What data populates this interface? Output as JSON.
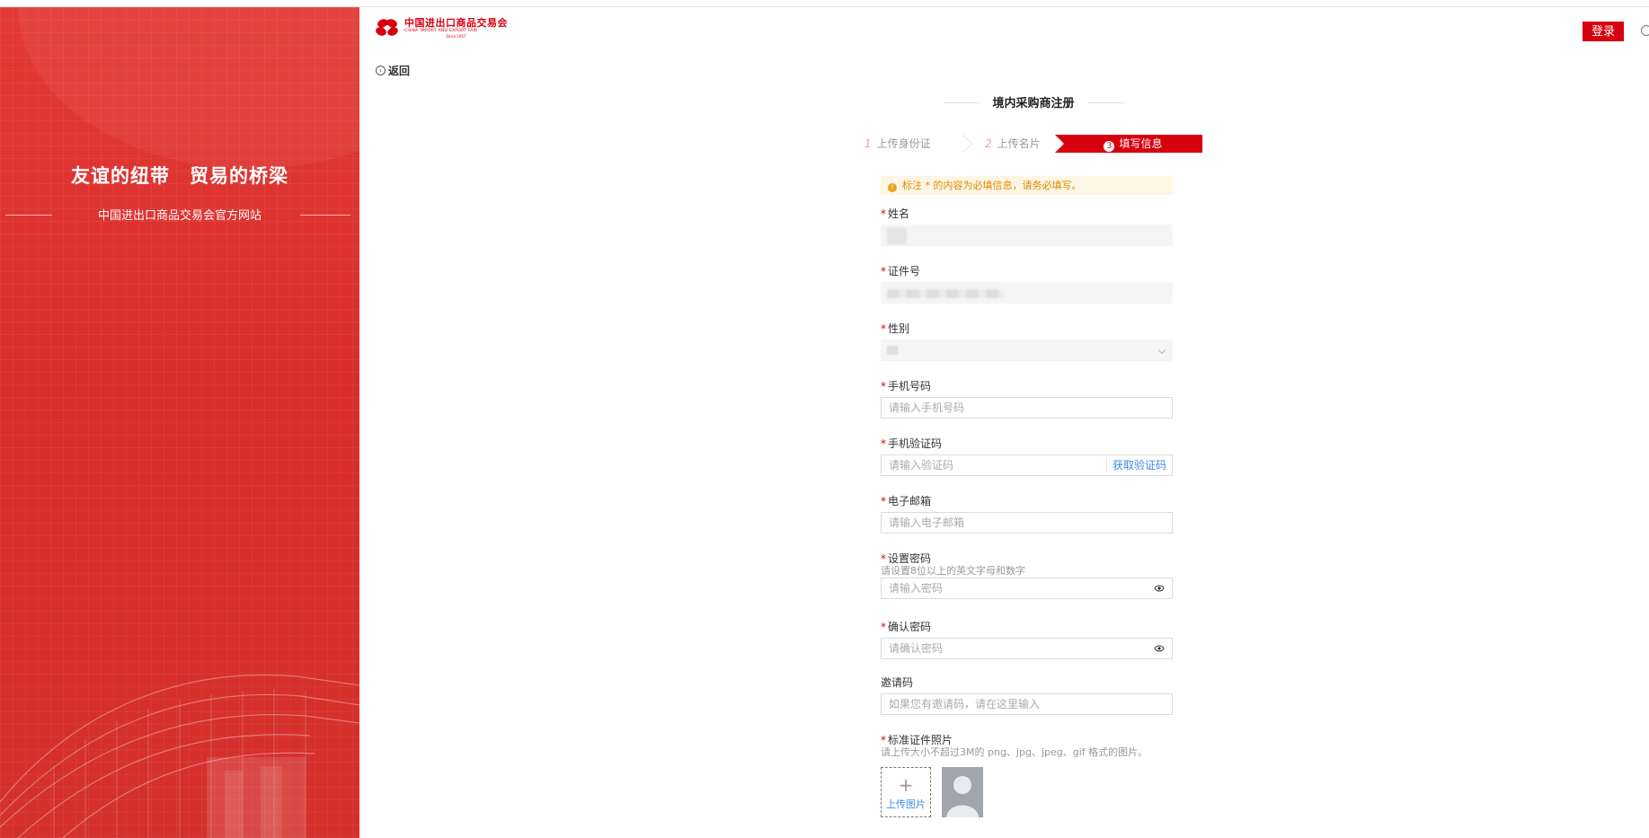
{
  "left": {
    "slogan": "友谊的纽带　贸易的桥梁",
    "subtitle": "中国进出口商品交易会官方网站"
  },
  "header": {
    "logo_cn": "中国进出口商品交易会",
    "logo_en": "CHINA IMPORT AND EXPORT FAIR",
    "logo_since": "Since 1957",
    "back": "返回",
    "login": "登录"
  },
  "form": {
    "title": "境内采购商注册",
    "steps": [
      {
        "num": "1",
        "label": "上传身份证"
      },
      {
        "num": "2",
        "label": "上传名片"
      },
      {
        "num": "3",
        "label": "填写信息"
      }
    ],
    "notice": "标注 * 的内容为必填信息，请务必填写。",
    "fields": {
      "name": {
        "label": "姓名"
      },
      "id_no": {
        "label": "证件号"
      },
      "gender": {
        "label": "性别"
      },
      "phone": {
        "label": "手机号码",
        "placeholder": "请输入手机号码"
      },
      "sms_code": {
        "label": "手机验证码",
        "placeholder": "请输入验证码",
        "action": "获取验证码"
      },
      "email": {
        "label": "电子邮箱",
        "placeholder": "请输入电子邮箱"
      },
      "password": {
        "label": "设置密码",
        "hint": "请设置8位以上的英文字母和数字",
        "placeholder": "请输入密码"
      },
      "confirm": {
        "label": "确认密码",
        "placeholder": "请确认密码"
      },
      "invite": {
        "label": "邀请码",
        "placeholder": "如果您有邀请码，请在这里输入"
      },
      "photo": {
        "label": "标准证件照片",
        "hint": "请上传大小不超过3M的 png、jpg、jpeg、gif 格式的图片。",
        "upload": "上传图片"
      }
    }
  },
  "colors": {
    "brand_red": "#d7000f",
    "link_blue": "#3c8be6",
    "notice_orange": "#e08a00"
  }
}
